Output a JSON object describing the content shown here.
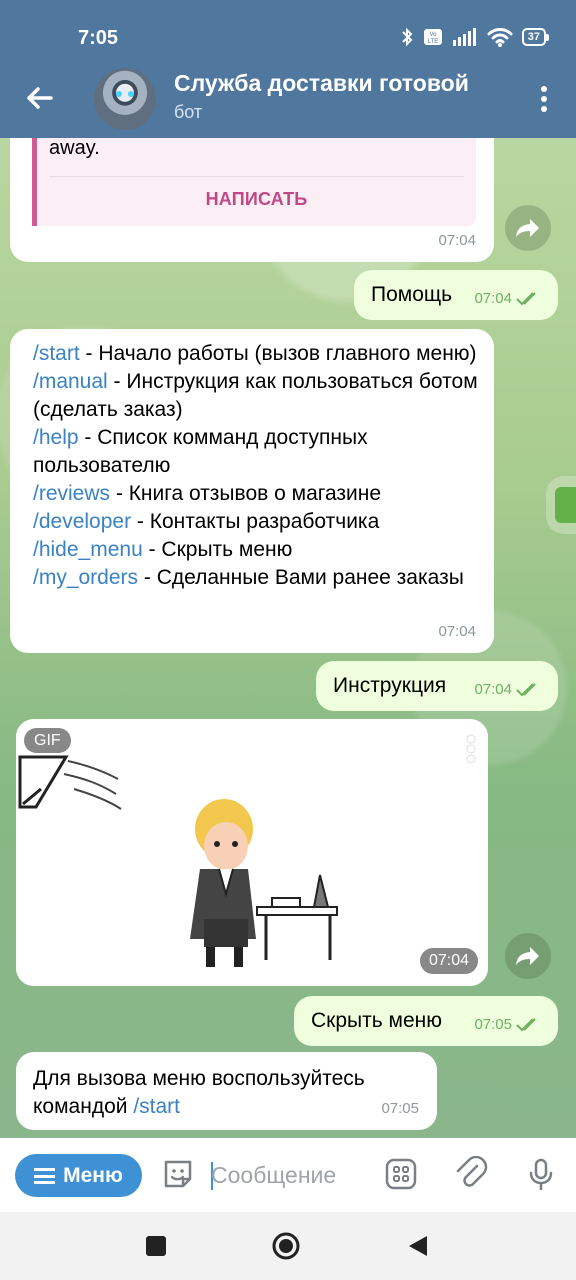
{
  "status": {
    "time": "7:05",
    "battery": "37"
  },
  "header": {
    "title": "Служба доставки готовой",
    "subtitle": "бот"
  },
  "messages": {
    "first": {
      "quote_text": "away.",
      "button": "НАПИСАТЬ",
      "time": "07:04"
    },
    "help": {
      "text": "Помощь",
      "time": "07:04"
    },
    "commands": {
      "items": [
        {
          "cmd": "/start",
          "desc": " - Начало работы (вызов главного меню)"
        },
        {
          "cmd": "/manual",
          "desc": " - Инструкция как пользоваться ботом (сделать заказ)"
        },
        {
          "cmd": "/help",
          "desc": " - Список комманд доступных пользователю"
        },
        {
          "cmd": "/reviews",
          "desc": " - Книга отзывов о магазине"
        },
        {
          "cmd": "/developer",
          "desc": " - Контакты разработчика"
        },
        {
          "cmd": "/hide_menu",
          "desc": " - Скрыть меню"
        },
        {
          "cmd": "/my_orders",
          "desc": " - Сделанные Вами ранее заказы"
        }
      ],
      "time": "07:04"
    },
    "manual": {
      "text": "Инструкция",
      "time": "07:04"
    },
    "gif": {
      "label": "GIF",
      "time": "07:04"
    },
    "hide": {
      "text": "Скрыть меню",
      "time": "07:05"
    },
    "final": {
      "text_before": "Для вызова меню воспользуйтесь командой ",
      "cmd": "/start",
      "time": "07:05"
    }
  },
  "input": {
    "menu_label": "Меню",
    "placeholder": "Сообщение"
  },
  "icons": {
    "back": "back-arrow-icon",
    "more": "more-vertical-icon",
    "forward": "forward-icon",
    "emoji": "sticker-icon",
    "apps": "apps-grid-icon",
    "attach": "paperclip-icon",
    "mic": "microphone-icon"
  },
  "colors": {
    "header": "#50779e",
    "accent": "#3f91d6",
    "outgoing_bubble": "#effedd",
    "quote_accent": "#cf5b93"
  }
}
